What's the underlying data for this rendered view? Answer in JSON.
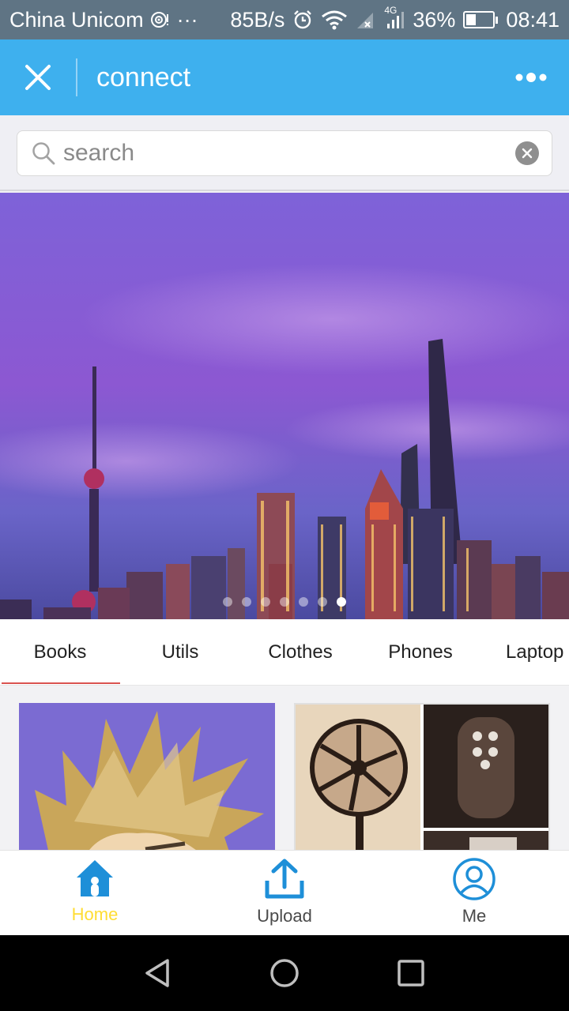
{
  "status_bar": {
    "carrier": "China Unicom",
    "ellipsis": "···",
    "speed": "85B/s",
    "network": "4G",
    "battery": "36%",
    "battery_level": 0.36,
    "time": "08:41"
  },
  "app_bar": {
    "title": "connect"
  },
  "search": {
    "placeholder": "search"
  },
  "banner": {
    "slide_count": 7,
    "active_slide": 7
  },
  "tabs": [
    {
      "label": "Books",
      "active": true
    },
    {
      "label": "Utils",
      "active": false
    },
    {
      "label": "Clothes",
      "active": false
    },
    {
      "label": "Phones",
      "active": false
    },
    {
      "label": "Laptop",
      "active": false
    }
  ],
  "bottom_nav": [
    {
      "label": "Home",
      "icon": "home-icon",
      "active": true
    },
    {
      "label": "Upload",
      "icon": "upload-icon",
      "active": false
    },
    {
      "label": "Me",
      "icon": "user-icon",
      "active": false
    }
  ],
  "colors": {
    "app_bar": "#3eb0ee",
    "status_bar": "#5f7484",
    "active_nav_label": "#ffdd33",
    "tab_indicator": "#d9534f"
  }
}
